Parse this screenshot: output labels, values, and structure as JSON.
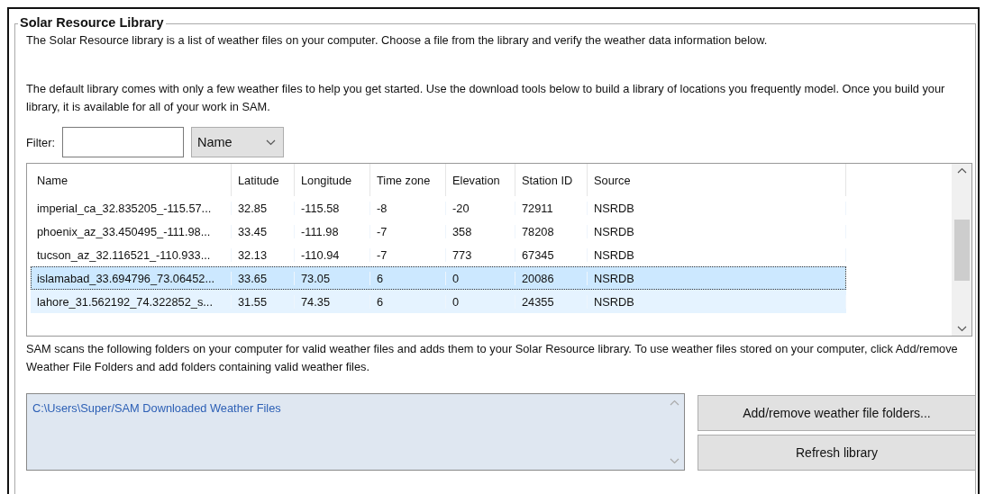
{
  "group_title": "Solar Resource Library",
  "intro": [
    "The Solar Resource library is a list of weather files on your computer. Choose a file from the library and verify the weather data information below.",
    "The default library comes with only a few weather files to help you get started. Use the download tools below to build a library of locations you frequently model. Once you build your library, it is available for all of your work in SAM."
  ],
  "filter": {
    "label": "Filter:",
    "dropdown": "Name"
  },
  "table": {
    "columns": [
      "Name",
      "Latitude",
      "Longitude",
      "Time zone",
      "Elevation",
      "Station ID",
      "Source"
    ],
    "rows": [
      {
        "cells": [
          "imperial_ca_32.835205_-115.57...",
          "32.85",
          "-115.58",
          "-8",
          "-20",
          "72911",
          "NSRDB"
        ],
        "selected": false,
        "hovered": false
      },
      {
        "cells": [
          "phoenix_az_33.450495_-111.98...",
          "33.45",
          "-111.98",
          "-7",
          "358",
          "78208",
          "NSRDB"
        ],
        "selected": false,
        "hovered": false
      },
      {
        "cells": [
          "tucson_az_32.116521_-110.933...",
          "32.13",
          "-110.94",
          "-7",
          "773",
          "67345",
          "NSRDB"
        ],
        "selected": false,
        "hovered": false
      },
      {
        "cells": [
          "islamabad_33.694796_73.06452...",
          "33.65",
          "73.05",
          "6",
          "0",
          "20086",
          "NSRDB"
        ],
        "selected": true,
        "hovered": false
      },
      {
        "cells": [
          "lahore_31.562192_74.322852_s...",
          "31.55",
          "74.35",
          "6",
          "0",
          "24355",
          "NSRDB"
        ],
        "selected": false,
        "hovered": true
      }
    ]
  },
  "folders_note": "SAM scans the following folders on your computer for valid weather files and adds them to your Solar Resource library. To use weather files stored on your computer, click Add/remove Weather File Folders and add folders containing valid weather files.",
  "folders": [
    "C:\\Users\\Super/SAM Downloaded Weather Files"
  ],
  "buttons": [
    "Add/remove weather file folders...",
    "Refresh library"
  ]
}
